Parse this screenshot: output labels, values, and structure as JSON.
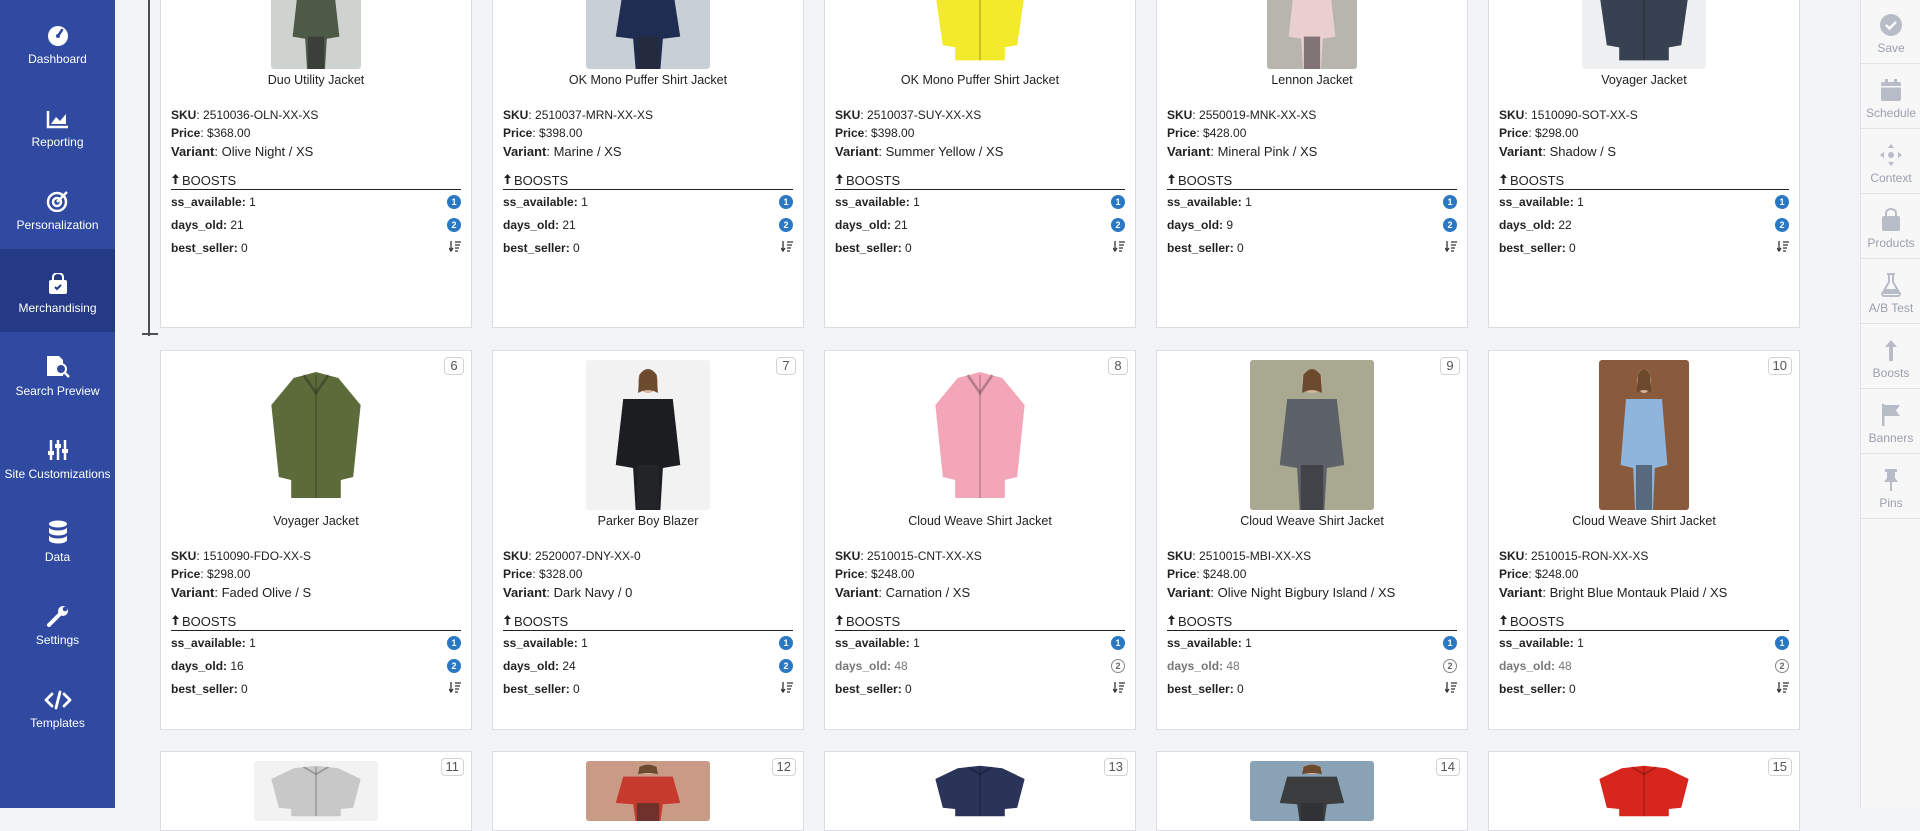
{
  "leftnav": {
    "items": [
      {
        "label": "Dashboard"
      },
      {
        "label": "Reporting"
      },
      {
        "label": "Personalization"
      },
      {
        "label": "Merchandising"
      },
      {
        "label": "Search Preview"
      },
      {
        "label": "Site Customizations"
      },
      {
        "label": "Data"
      },
      {
        "label": "Settings"
      },
      {
        "label": "Templates"
      }
    ]
  },
  "rightnav": {
    "items": [
      {
        "label": "Save"
      },
      {
        "label": "Schedule"
      },
      {
        "label": "Context"
      },
      {
        "label": "Products"
      },
      {
        "label": "A/B Test"
      },
      {
        "label": "Boosts"
      },
      {
        "label": "Banners"
      },
      {
        "label": "Pins"
      }
    ]
  },
  "labels": {
    "sku": "SKU",
    "price": "Price",
    "variant": "Variant",
    "boosts": "BOOSTS",
    "ss_available": "ss_available:",
    "days_old": "days_old:",
    "best_seller": "best_seller:"
  },
  "products": [
    {
      "name": "Duo Utility Jacket",
      "sku": "2510036-OLN-XX-XS",
      "price": "$368.00",
      "variant": "Olive Night / XS",
      "ss_available": "1",
      "days_old": "21",
      "best_seller": "0"
    },
    {
      "name": "OK Mono Puffer Shirt Jacket",
      "sku": "2510037-MRN-XX-XS",
      "price": "$398.00",
      "variant": "Marine / XS",
      "ss_available": "1",
      "days_old": "21",
      "best_seller": "0"
    },
    {
      "name": "OK Mono Puffer Shirt Jacket",
      "sku": "2510037-SUY-XX-XS",
      "price": "$398.00",
      "variant": "Summer Yellow / XS",
      "ss_available": "1",
      "days_old": "21",
      "best_seller": "0"
    },
    {
      "name": "Lennon Jacket",
      "sku": "2550019-MNK-XX-XS",
      "price": "$428.00",
      "variant": "Mineral Pink / XS",
      "ss_available": "1",
      "days_old": "9",
      "best_seller": "0"
    },
    {
      "name": "Voyager Jacket",
      "sku": "1510090-SOT-XX-S",
      "price": "$298.00",
      "variant": "Shadow / S",
      "ss_available": "1",
      "days_old": "22",
      "best_seller": "0"
    },
    {
      "rank": "6",
      "name": "Voyager Jacket",
      "sku": "1510090-FDO-XX-S",
      "price": "$298.00",
      "variant": "Faded Olive / S",
      "ss_available": "1",
      "days_old": "16",
      "best_seller": "0"
    },
    {
      "rank": "7",
      "name": "Parker Boy Blazer",
      "sku": "2520007-DNY-XX-0",
      "price": "$328.00",
      "variant": "Dark Navy / 0",
      "ss_available": "1",
      "days_old": "24",
      "best_seller": "0"
    },
    {
      "rank": "8",
      "name": "Cloud Weave Shirt Jacket",
      "sku": "2510015-CNT-XX-XS",
      "price": "$248.00",
      "variant": "Carnation / XS",
      "ss_available": "1",
      "days_old": "48",
      "best_seller": "0"
    },
    {
      "rank": "9",
      "name": "Cloud Weave Shirt Jacket",
      "sku": "2510015-MBI-XX-XS",
      "price": "$248.00",
      "variant": "Olive Night Bigbury Island / XS",
      "ss_available": "1",
      "days_old": "48",
      "best_seller": "0"
    },
    {
      "rank": "10",
      "name": "Cloud Weave Shirt Jacket",
      "sku": "2510015-RON-XX-XS",
      "price": "$248.00",
      "variant": "Bright Blue Montauk Plaid / XS",
      "ss_available": "1",
      "days_old": "48",
      "best_seller": "0"
    },
    {
      "rank": "11"
    },
    {
      "rank": "12"
    },
    {
      "rank": "13"
    },
    {
      "rank": "14"
    },
    {
      "rank": "15"
    }
  ],
  "badges": {
    "one": "1",
    "two": "2"
  },
  "colors": {
    "nav_bg": "#2f4aa0",
    "nav_active": "#243a86",
    "badge": "#2a78c3"
  }
}
